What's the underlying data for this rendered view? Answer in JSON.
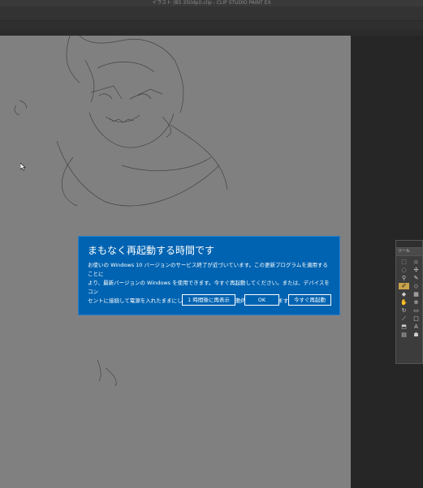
{
  "window": {
    "title": "イラスト (B5 350dpi).clip - CLIP STUDIO PAINT EX"
  },
  "tool_palette": {
    "header": "",
    "tab_label": "ツール",
    "tools": [
      "select-icon",
      "marquee-icon",
      "lasso-icon",
      "move-icon",
      "eyedropper-icon",
      "pen-icon",
      "brush-icon",
      "eraser-icon",
      "fill-icon",
      "gradient-icon",
      "text-icon",
      "hand-icon",
      "zoom-icon",
      "rotate-icon",
      "frame-icon",
      "ruler-icon",
      "shape-icon",
      "figure-icon",
      "layer-icon",
      "correct-icon"
    ],
    "text_tool_glyph": "A"
  },
  "dialog": {
    "title": "まもなく再起動する時間です",
    "body_lines": [
      "お使いの Windows 10 バージョンのサービス終了が近づいています。この更新プログラムを適用することに",
      "より、最新バージョンの Windows を使用できます。今すぐ再起動してください。または、デバイスをコン",
      "セントに接続して電源を入れたままにしておくと、18:10 に自動的に再起動されます。"
    ],
    "buttons": {
      "later": "1 時間後に再表示",
      "ok": "OK",
      "restart_now": "今すぐ再起動"
    },
    "colors": {
      "background": "#0063b1",
      "text": "#ffffff"
    }
  },
  "colors": {
    "canvas": "#808080",
    "app_background": "#2a2a2a"
  }
}
